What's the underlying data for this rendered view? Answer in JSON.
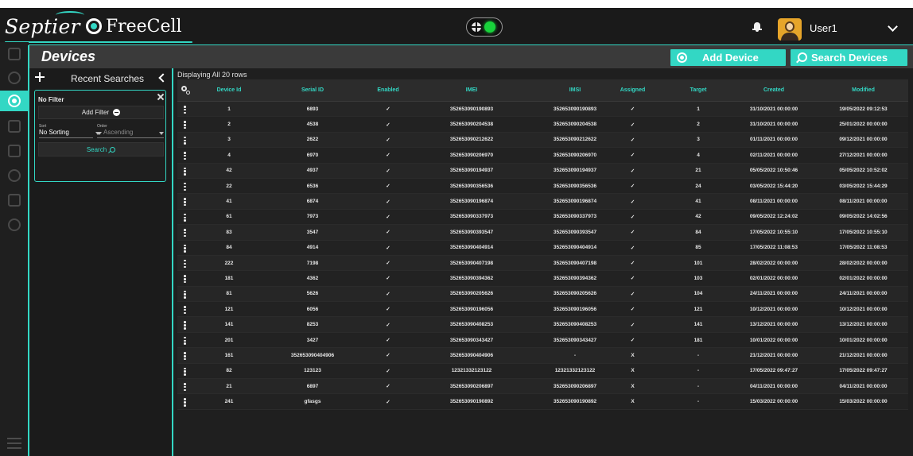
{
  "header": {
    "brand": "Septier",
    "product": "FreeCell",
    "username": "User1"
  },
  "page": {
    "title": "Devices",
    "add_device_label": "Add Device",
    "search_devices_label": "Search Devices"
  },
  "recent": {
    "title": "Recent Searches",
    "filter_label": "No Filter",
    "add_filter_label": "Add Filter",
    "sort_label": "Sort",
    "sort_value": "No Sorting",
    "order_label": "Order",
    "order_value": "Ascending",
    "search_label": "Search"
  },
  "table": {
    "rowcount": "Displaying All 20 rows",
    "columns": [
      "Device Id",
      "Serial ID",
      "Enabled",
      "IMEI",
      "IMSI",
      "Assigned",
      "Target",
      "Created",
      "Modified"
    ],
    "rows": [
      [
        "1",
        "6893",
        "✓",
        "352653090190893",
        "352653090190893",
        "✓",
        "1",
        "31/10/2021 00:00:00",
        "19/05/2022 09:12:53"
      ],
      [
        "2",
        "4538",
        "✓",
        "352653090204538",
        "352653090204538",
        "✓",
        "2",
        "31/10/2021 00:00:00",
        "25/01/2022 00:00:00"
      ],
      [
        "3",
        "2622",
        "✓",
        "352653090212622",
        "352653090212622",
        "✓",
        "3",
        "01/11/2021 00:00:00",
        "09/12/2021 00:00:00"
      ],
      [
        "4",
        "6970",
        "✓",
        "352653090206970",
        "352653090206970",
        "✓",
        "4",
        "02/11/2021 00:00:00",
        "27/12/2021 00:00:00"
      ],
      [
        "42",
        "4937",
        "✓",
        "352653090194937",
        "352653090194937",
        "✓",
        "21",
        "05/05/2022 10:50:46",
        "05/05/2022 10:52:02"
      ],
      [
        "22",
        "6536",
        "✓",
        "352653090356536",
        "352653090356536",
        "✓",
        "24",
        "03/05/2022 15:44:20",
        "03/05/2022 15:44:29"
      ],
      [
        "41",
        "6874",
        "✓",
        "352653090196874",
        "352653090196874",
        "✓",
        "41",
        "08/11/2021 00:00:00",
        "08/11/2021 00:00:00"
      ],
      [
        "61",
        "7973",
        "✓",
        "352653090337973",
        "352653090337973",
        "✓",
        "42",
        "09/05/2022 12:24:02",
        "09/05/2022 14:02:56"
      ],
      [
        "83",
        "3547",
        "✓",
        "352653090393547",
        "352653090393547",
        "✓",
        "84",
        "17/05/2022 10:55:10",
        "17/05/2022 10:55:10"
      ],
      [
        "84",
        "4914",
        "✓",
        "352653090404914",
        "352653090404914",
        "✓",
        "85",
        "17/05/2022 11:08:53",
        "17/05/2022 11:08:53"
      ],
      [
        "222",
        "7198",
        "✓",
        "352653090407198",
        "352653090407198",
        "✓",
        "101",
        "28/02/2022 00:00:00",
        "28/02/2022 00:00:00"
      ],
      [
        "181",
        "4362",
        "✓",
        "352653090394362",
        "352653090394362",
        "✓",
        "103",
        "02/01/2022 00:00:00",
        "02/01/2022 00:00:00"
      ],
      [
        "81",
        "5626",
        "✓",
        "352653090205626",
        "352653090205626",
        "✓",
        "104",
        "24/11/2021 00:00:00",
        "24/11/2021 00:00:00"
      ],
      [
        "121",
        "6056",
        "✓",
        "352653090196056",
        "352653090196056",
        "✓",
        "121",
        "10/12/2021 00:00:00",
        "10/12/2021 00:00:00"
      ],
      [
        "141",
        "8253",
        "✓",
        "352653090408253",
        "352653090408253",
        "✓",
        "141",
        "13/12/2021 00:00:00",
        "13/12/2021 00:00:00"
      ],
      [
        "201",
        "3427",
        "✓",
        "352653090343427",
        "352653090343427",
        "✓",
        "181",
        "10/01/2022 00:00:00",
        "10/01/2022 00:00:00"
      ],
      [
        "161",
        "352653090404906",
        "✓",
        "352653090404906",
        "-",
        "X",
        "-",
        "21/12/2021 00:00:00",
        "21/12/2021 00:00:00"
      ],
      [
        "82",
        "123123",
        "✓",
        "12321332123122",
        "12321332123122",
        "X",
        "-",
        "17/05/2022 09:47:27",
        "17/05/2022 09:47:27"
      ],
      [
        "21",
        "6897",
        "✓",
        "352653090206897",
        "352653090206897",
        "X",
        "-",
        "04/11/2021 00:00:00",
        "04/11/2021 00:00:00"
      ],
      [
        "241",
        "gfasgs",
        "✓",
        "352653090190892",
        "352653090190892",
        "X",
        "-",
        "15/03/2022 00:00:00",
        "15/03/2022 00:00:00"
      ]
    ]
  },
  "colors": {
    "accent": "#33d7c4",
    "status_online": "#18d23b"
  },
  "icons": {
    "status": "globe-icon",
    "notifications": "bell-icon",
    "user_menu": "chevron-down-icon",
    "panel_collapse": "chevron-left-icon",
    "row_menu": "kebab-icon",
    "column_settings": "settings-icon"
  }
}
